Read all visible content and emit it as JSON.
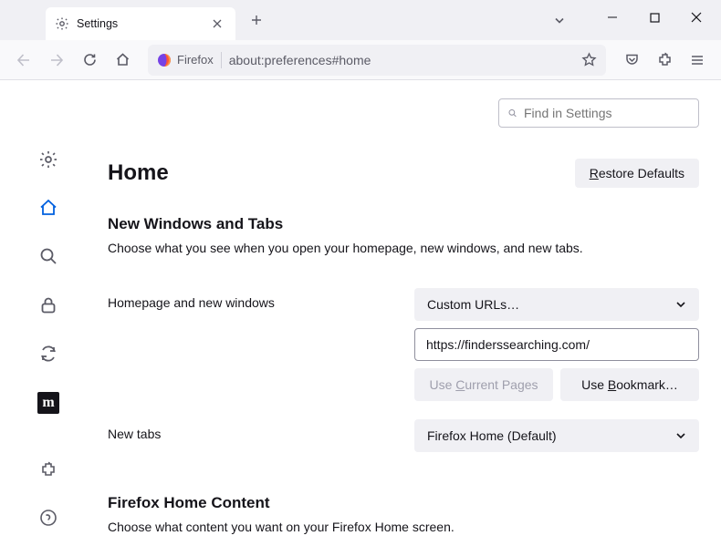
{
  "window": {
    "tab_title": "Settings"
  },
  "urlbar": {
    "identity_label": "Firefox",
    "url": "about:preferences#home"
  },
  "search": {
    "placeholder": "Find in Settings"
  },
  "page": {
    "title": "Home",
    "restore_label": "Restore Defaults",
    "section1": {
      "title": "New Windows and Tabs",
      "desc": "Choose what you see when you open your homepage, new windows, and new tabs."
    },
    "homepage": {
      "label": "Homepage and new windows",
      "select_value": "Custom URLs…",
      "url_value": "https://finderssearching.com/",
      "use_current": "Use Current Pages",
      "use_bookmark": "Use Bookmark…"
    },
    "newtabs": {
      "label": "New tabs",
      "select_value": "Firefox Home (Default)"
    },
    "section2": {
      "title": "Firefox Home Content",
      "desc": "Choose what content you want on your Firefox Home screen."
    }
  }
}
